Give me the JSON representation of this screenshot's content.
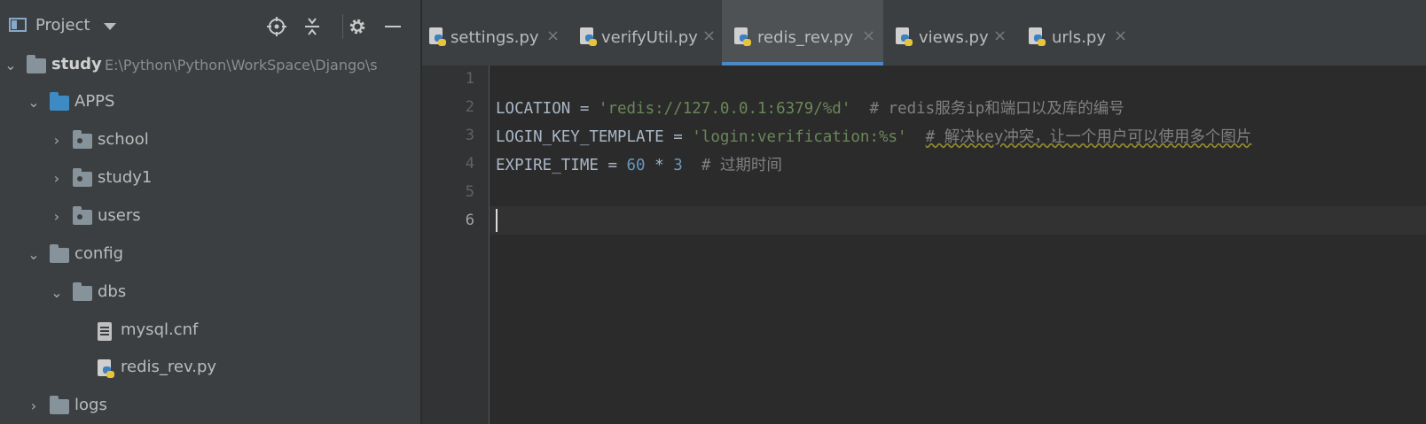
{
  "project_panel": {
    "title": "Project",
    "icons": {
      "locate": "crosshair-icon",
      "collapse": "collapse-all-icon",
      "settings": "gear-icon",
      "hide": "minimize-icon"
    },
    "tree": [
      {
        "label": "study",
        "path": "E:\\Python\\Python\\WorkSpace\\Django\\s",
        "expanded": true,
        "type": "root"
      },
      {
        "label": "APPS",
        "expanded": true,
        "type": "folder-blue"
      },
      {
        "label": "school",
        "expanded": false,
        "type": "package"
      },
      {
        "label": "study1",
        "expanded": false,
        "type": "package"
      },
      {
        "label": "users",
        "expanded": false,
        "type": "package"
      },
      {
        "label": "config",
        "expanded": true,
        "type": "folder"
      },
      {
        "label": "dbs",
        "expanded": true,
        "type": "folder"
      },
      {
        "label": "mysql.cnf",
        "type": "text-file"
      },
      {
        "label": "redis_rev.py",
        "type": "python-file"
      },
      {
        "label": "logs",
        "expanded": false,
        "type": "folder"
      }
    ]
  },
  "tabs": [
    {
      "label": "settings.py",
      "active": false
    },
    {
      "label": "verifyUtil.py",
      "active": false
    },
    {
      "label": "redis_rev.py",
      "active": true
    },
    {
      "label": "views.py",
      "active": false
    },
    {
      "label": "urls.py",
      "active": false
    }
  ],
  "close_glyph": "×",
  "editor": {
    "line_numbers": [
      "1",
      "2",
      "3",
      "4",
      "5",
      "6"
    ],
    "current_line": 6,
    "lines": [
      {
        "n": 2,
        "var": "LOCATION",
        "op": " = ",
        "str": "'redis://127.0.0.1:6379/%d'",
        "comment": "  # redis服务ip和端口以及库的编号"
      },
      {
        "n": 3,
        "var": "LOGIN_KEY_TEMPLATE",
        "op": " = ",
        "str": "'login:verification:%s'",
        "comment": "# 解决key冲突，让一个用户可以使用多个图片"
      },
      {
        "n": 4,
        "var": "EXPIRE_TIME",
        "op": " = ",
        "num1": "60",
        "mul": " * ",
        "num2": "3",
        "comment": "  # 过期时间"
      }
    ]
  },
  "colors": {
    "panel_bg": "#3c3f41",
    "editor_bg": "#2b2b2b",
    "active_tab_underline": "#4a88c7",
    "string": "#6a8759",
    "number": "#6897bb",
    "comment": "#808080"
  }
}
